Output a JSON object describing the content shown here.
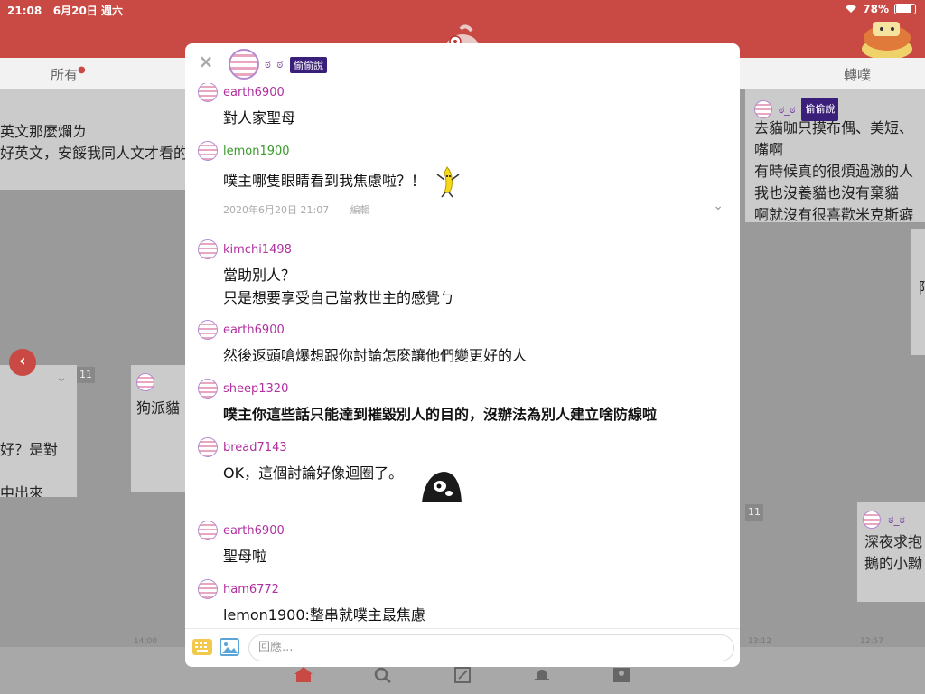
{
  "status_bar": {
    "time": "21:08",
    "date": "6月20日 週六",
    "battery": "78%"
  },
  "tabs": {
    "all": "所有",
    "replurk": "轉噗"
  },
  "background": {
    "card_left_top": [
      "英文那麼爛ㄌ",
      "好英文，安餒我同人文才看的"
    ],
    "card_right_top": [
      "去貓咖只摸布偶、美短、",
      "嘴啊",
      "有時候真的很煩過激的人",
      "我也沒養貓也沒有棄貓",
      "啊就沒有很喜歡米克斯癖"
    ],
    "card_left_mid": [
      "好？是對",
      "中出來"
    ],
    "card_mid": [
      "狗派貓"
    ],
    "card_right_bottom": [
      "深夜求抱",
      "鵝的小黝"
    ],
    "card_right_mid_char": "陌",
    "badge_11": "11",
    "times": [
      "14:00",
      "13:12",
      "12:57"
    ],
    "anon_name": "ಠ_ಠ",
    "whisper_label": "偷偷說"
  },
  "modal": {
    "anon_name": "ಠ_ಠ",
    "whisper_label": "偷偷說",
    "close_label": "×",
    "responses": [
      {
        "user": "earth6900",
        "color": "#b0309f",
        "text": "對人家聖母"
      },
      {
        "user": "lemon1900",
        "color": "#3a9a2a",
        "text": "噗主哪隻眼睛看到我焦慮啦？！"
      },
      {
        "user": "kimchi1498",
        "color": "#b0309f",
        "text": "當助別人？",
        "text2": "只是想要享受自己當救世主的感覺ㄅ"
      },
      {
        "user": "earth6900",
        "color": "#b0309f",
        "text": "然後返頭嗆爆想跟你討論怎麼讓他們變更好的人"
      },
      {
        "user": "sheep1320",
        "color": "#b0309f",
        "text": "噗主你這些話只能達到摧毀別人的目的，沒辦法為別人建立啥防線啦"
      },
      {
        "user": "bread7143",
        "color": "#b0309f",
        "text": "OK，這個討論好像迴圈了。"
      },
      {
        "user": "earth6900",
        "color": "#b0309f",
        "text": "聖母啦"
      },
      {
        "user": "ham6772",
        "color": "#b0309f",
        "text": "lemon1900:整串就噗主最焦慮"
      }
    ],
    "meta": {
      "timestamp": "2020年6月20日 21:07",
      "edit_label": "編輯"
    },
    "reply_placeholder": "回應..."
  }
}
